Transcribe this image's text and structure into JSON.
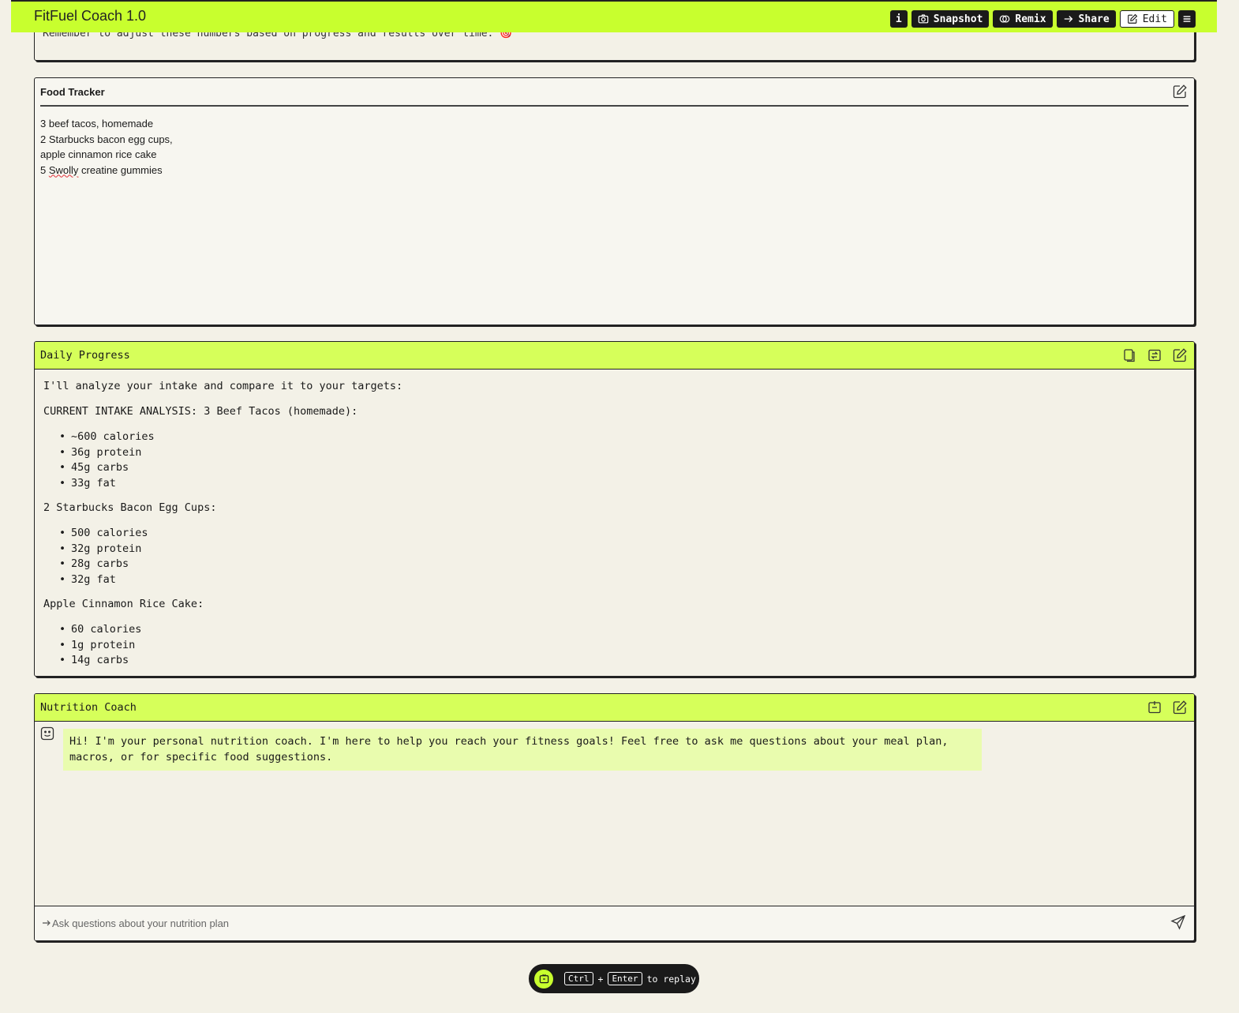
{
  "app": {
    "title": "FitFuel Coach 1.0"
  },
  "toolbar": {
    "info_label": "i",
    "snapshot_label": "Snapshot",
    "remix_label": "Remix",
    "share_label": "Share",
    "edit_label": "Edit"
  },
  "previous_panel": {
    "last_line": "Remember to adjust these numbers based on progress and results over time. 🎯"
  },
  "food_tracker": {
    "title": "Food Tracker",
    "lines": [
      "3 beef tacos, homemade",
      "2 Starbucks bacon egg cups,",
      "apple cinnamon rice cake"
    ],
    "last_line_prefix": "5 ",
    "last_line_misspelled": "Swolly",
    "last_line_suffix": " creatine gummies"
  },
  "daily_progress": {
    "title": "Daily Progress",
    "intro": "I'll analyze your intake and compare it to your targets:",
    "sections": [
      {
        "heading": "CURRENT INTAKE ANALYSIS: 3 Beef Tacos (homemade):",
        "items": [
          "~600 calories",
          "36g protein",
          "45g carbs",
          "33g fat"
        ]
      },
      {
        "heading": "2 Starbucks Bacon Egg Cups:",
        "items": [
          "500 calories",
          "32g protein",
          "28g carbs",
          "32g fat"
        ]
      },
      {
        "heading": "Apple Cinnamon Rice Cake:",
        "items": [
          "60 calories",
          "1g protein",
          "14g carbs"
        ]
      }
    ]
  },
  "nutrition_coach": {
    "title": "Nutrition Coach",
    "message": "Hi! I'm your personal nutrition coach. I'm here to help you reach your fitness goals! Feel free to ask me questions about your meal plan, macros, or for specific food suggestions.",
    "input_placeholder": "Ask questions about your nutrition plan"
  },
  "replay": {
    "key1": "Ctrl",
    "plus": "+",
    "key2": "Enter",
    "suffix": "to replay"
  },
  "colors": {
    "accent": "#c8ff2e",
    "panel_head": "#d6ff5a",
    "bubble": "#e9fcae",
    "background": "#f3f1e7"
  }
}
